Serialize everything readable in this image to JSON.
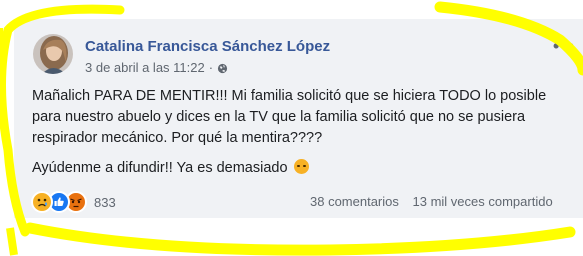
{
  "post": {
    "author": "Catalina Francisca Sánchez López",
    "timestamp": "3 de abril a las 11:22",
    "separator": "·",
    "privacy_icon": "globe-icon",
    "more_icon": "ellipsis-icon",
    "more_label": "•••",
    "paragraph_1": "Mañalich PARA DE MENTIR!!! Mi familia solicitó que se hiciera TODO lo posible para nuestro abuelo y dices en la TV que la familia solicitó que no se pusiera respirador mecánico. Por qué la mentira????",
    "paragraph_2": "Ayúdenme a difundir!! Ya es demasiado",
    "paragraph_2_emoji": "angry-face-emoji"
  },
  "footer": {
    "reactions": [
      "sad",
      "like",
      "angry"
    ],
    "reaction_count": "833",
    "comments": "38 comentarios",
    "shares": "13 mil veces compartido"
  },
  "colors": {
    "author": "#385898",
    "meta": "#606770",
    "card_bg": "#f0f2f5",
    "highlight": "#ffff00"
  }
}
